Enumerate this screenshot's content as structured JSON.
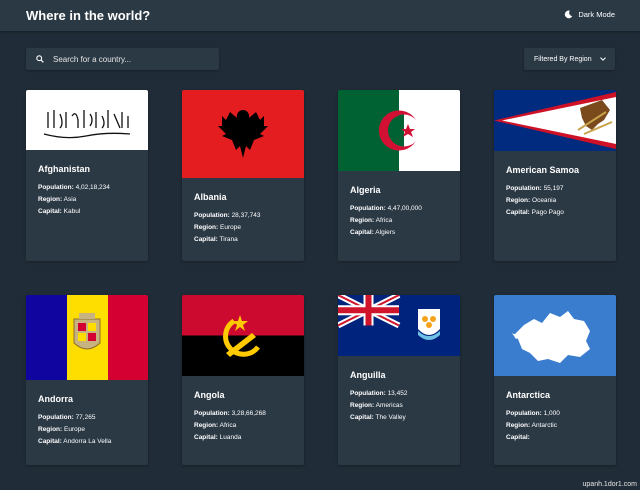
{
  "header": {
    "title": "Where in the world?",
    "dark_mode_label": "Dark Mode",
    "theme_icon": "moon-icon"
  },
  "search": {
    "placeholder": "Search for a country...",
    "value": "",
    "icon": "search-icon"
  },
  "filter": {
    "label": "Filtered By Region",
    "icon": "chevron-down-icon"
  },
  "labels": {
    "population": "Population:",
    "region": "Region:",
    "capital": "Capital:"
  },
  "countries": [
    {
      "name": "Afghanistan",
      "population": "4,02,18,234",
      "region": "Asia",
      "capital": "Kabul"
    },
    {
      "name": "Albania",
      "population": "28,37,743",
      "region": "Europe",
      "capital": "Tirana"
    },
    {
      "name": "Algeria",
      "population": "4,47,00,000",
      "region": "Africa",
      "capital": "Algiers"
    },
    {
      "name": "American Samoa",
      "population": "55,197",
      "region": "Oceania",
      "capital": "Pago Pago"
    },
    {
      "name": "Andorra",
      "population": "77,265",
      "region": "Europe",
      "capital": "Andorra La Vella"
    },
    {
      "name": "Angola",
      "population": "3,28,66,268",
      "region": "Africa",
      "capital": "Luanda"
    },
    {
      "name": "Anguilla",
      "population": "13,452",
      "region": "Americas",
      "capital": "The Valley"
    },
    {
      "name": "Antarctica",
      "population": "1,000",
      "region": "Antarctic",
      "capital": ""
    }
  ],
  "colors": {
    "background": "#202c37",
    "element": "#2b3945",
    "text": "#ffffff"
  },
  "watermark": "upanh.1dor1.com"
}
